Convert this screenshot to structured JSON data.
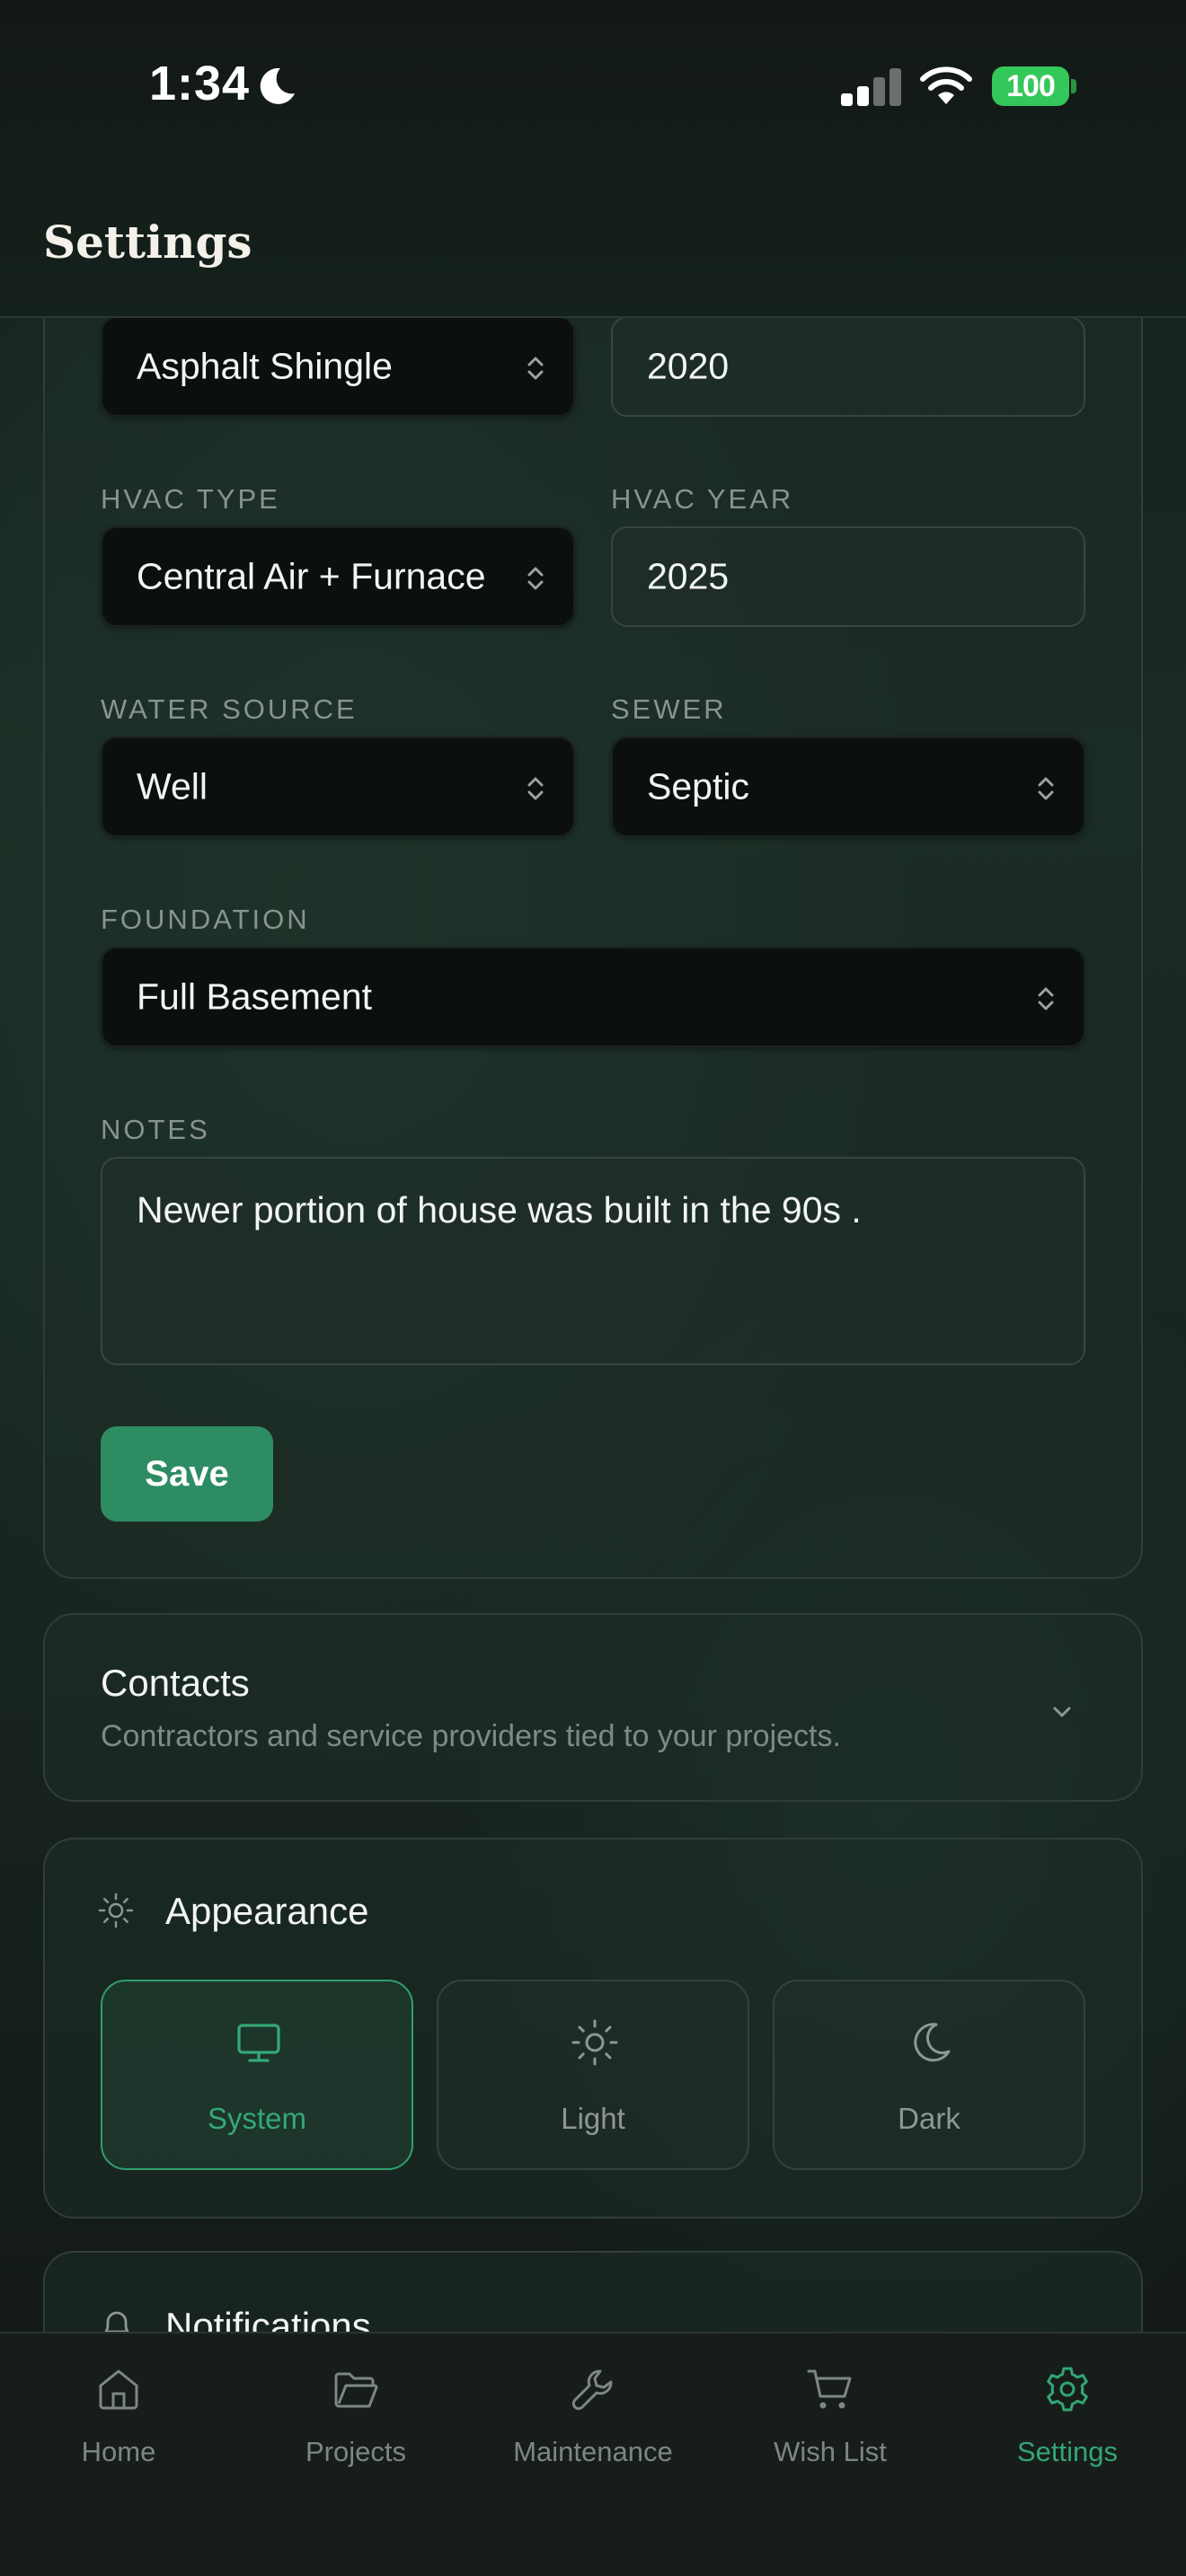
{
  "status_bar": {
    "time": "1:34",
    "battery": "100"
  },
  "header": {
    "title": "Settings"
  },
  "property_form": {
    "roof_type": {
      "value": "Asphalt Shingle"
    },
    "roof_year": {
      "value": "2020"
    },
    "hvac_type": {
      "label": "HVAC TYPE",
      "value": "Central Air + Furnace"
    },
    "hvac_year": {
      "label": "HVAC YEAR",
      "value": "2025"
    },
    "water_source": {
      "label": "WATER SOURCE",
      "value": "Well"
    },
    "sewer": {
      "label": "SEWER",
      "value": "Septic"
    },
    "foundation": {
      "label": "FOUNDATION",
      "value": "Full Basement"
    },
    "notes": {
      "label": "NOTES",
      "value": "Newer portion of house was built in the 90s ."
    },
    "save_label": "Save"
  },
  "contacts": {
    "title": "Contacts",
    "subtitle": "Contractors and service providers tied to your projects."
  },
  "appearance": {
    "title": "Appearance",
    "options": [
      {
        "label": "System",
        "icon": "monitor-icon",
        "selected": true
      },
      {
        "label": "Light",
        "icon": "sun-icon",
        "selected": false
      },
      {
        "label": "Dark",
        "icon": "moon-icon",
        "selected": false
      }
    ]
  },
  "notifications": {
    "title": "Notifications"
  },
  "tab_bar": {
    "items": [
      {
        "label": "Home",
        "icon": "home-icon"
      },
      {
        "label": "Projects",
        "icon": "folder-icon"
      },
      {
        "label": "Maintenance",
        "icon": "wrench-icon"
      },
      {
        "label": "Wish List",
        "icon": "cart-icon"
      },
      {
        "label": "Settings",
        "icon": "gear-icon",
        "active": true
      }
    ]
  },
  "colors": {
    "accent": "#2e8c63",
    "accent_text": "#32a674",
    "battery": "#34c759",
    "background": "#18241f"
  }
}
